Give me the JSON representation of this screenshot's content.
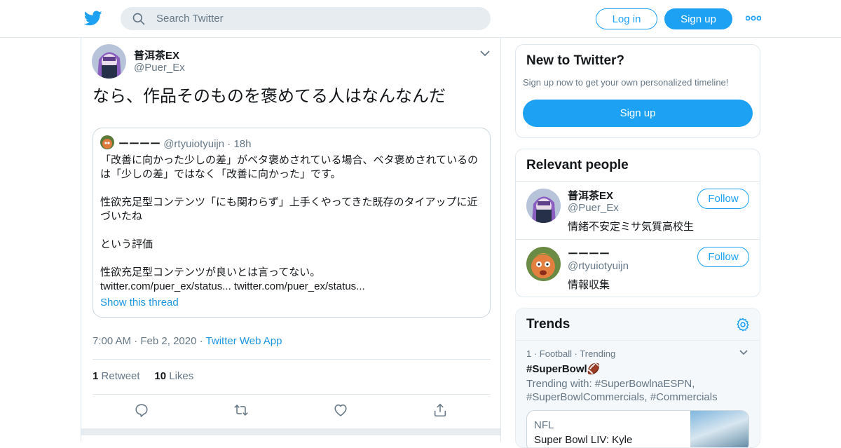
{
  "header": {
    "search_placeholder": "Search Twitter",
    "login_label": "Log in",
    "signup_label": "Sign up"
  },
  "tweet": {
    "author_name": "普洱茶EX",
    "author_handle": "@Puer_Ex",
    "text": "なら、作品そのものを褒めてる人はなんなんだ",
    "quoted": {
      "name": "ーーーー",
      "handle": "@rtyuiotyuijn",
      "separator": "·",
      "time": "18h",
      "paragraphs": [
        "「改善に向かった少しの差」がベタ褒めされている場合、ベタ褒めされているのは「少しの差」ではなく「改善に向かった」です。",
        "性欲充足型コンテンツ「にも関わらず」上手くやってきた既存のタイアップに近づいたね",
        "という評価",
        "性欲充足型コンテンツが良いとは言ってない。",
        "twitter.com/puer_ex/status... twitter.com/puer_ex/status..."
      ],
      "thread_link": "Show this thread"
    },
    "time": "7:00 AM",
    "separator": "·",
    "date": "Feb 2, 2020",
    "app": "Twitter Web App",
    "retweets_count": "1",
    "retweets_label": "Retweet",
    "likes_count": "10",
    "likes_label": "Likes"
  },
  "sidebar": {
    "new_to_twitter": {
      "title": "New to Twitter?",
      "subtitle": "Sign up now to get your own personalized timeline!",
      "button": "Sign up"
    },
    "relevant_people": {
      "title": "Relevant people",
      "people": [
        {
          "name": "普洱茶EX",
          "handle": "@Puer_Ex",
          "bio": "情緒不安定ミサ気質高校生",
          "follow_label": "Follow"
        },
        {
          "name": "ーーーー",
          "handle": "@rtyuiotyuijn",
          "bio": "情報収集",
          "follow_label": "Follow"
        }
      ]
    },
    "trends": {
      "title": "Trends",
      "items": [
        {
          "meta": "1 · Football · Trending",
          "tag": "#SuperBowl🏈",
          "with": "Trending with: #SuperBowlnaESPN, #SuperBowlCommercials, #Commercials",
          "news_source": "NFL",
          "news_headline": "Super Bowl LIV: Kyle"
        }
      ]
    }
  },
  "colors": {
    "brand_blue": "#1da1f2",
    "link_blue": "#1b95e0",
    "muted_text": "#657786",
    "border": "#e1e8ed"
  },
  "icons": [
    "twitter-bird-icon",
    "search-icon",
    "more-dots-icon",
    "chevron-down-icon",
    "reply-icon",
    "retweet-icon",
    "like-icon",
    "share-icon",
    "gear-icon"
  ]
}
